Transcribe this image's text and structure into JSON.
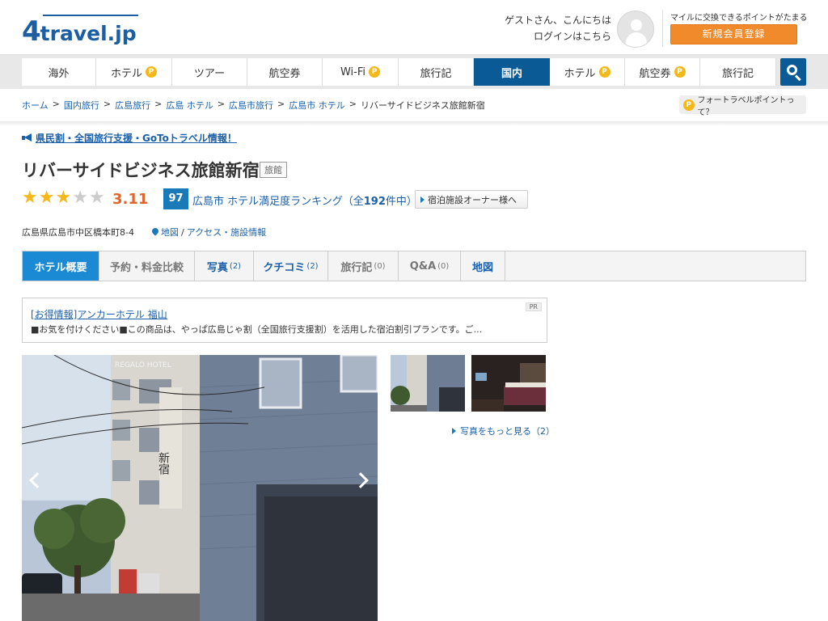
{
  "header": {
    "logo_number": "4",
    "logo_word": "travel.jp",
    "greeting_line1": "ゲストさん、こんにちは",
    "greeting_line2": "ログインはこちら",
    "points_note": "マイルに交換できるポイントがたまる",
    "register_label": "新規会員登録"
  },
  "nav": {
    "items": [
      {
        "label": "海外",
        "active": true,
        "points": false
      },
      {
        "label": "ホテル",
        "active": false,
        "points": true
      },
      {
        "label": "ツアー",
        "active": false,
        "points": false
      },
      {
        "label": "航空券",
        "active": false,
        "points": false
      },
      {
        "label": "Wi-Fi",
        "active": false,
        "points": true
      },
      {
        "label": "旅行記",
        "active": false,
        "points": false
      },
      {
        "label": "国内",
        "active": true,
        "points": false
      },
      {
        "label": "ホテル",
        "active": false,
        "points": true
      },
      {
        "label": "航空券",
        "active": false,
        "points": true
      },
      {
        "label": "旅行記",
        "active": false,
        "points": false
      }
    ],
    "points_glyph": "P"
  },
  "breadcrumb": {
    "items": [
      "ホーム",
      "国内旅行",
      "広島旅行",
      "広島 ホテル",
      "広島市旅行",
      "広島市 ホテル"
    ],
    "current": "リバーサイドビジネス旅館新宿",
    "separator": ">"
  },
  "points_help": "フォートラベルポイントって？",
  "promo": "県民割・全国旅行支援・GoToトラベル情報！",
  "hotel": {
    "name": "リバーサイドビジネス旅館新宿",
    "type": "旅館",
    "rating": 3.11,
    "rating_text": "3.11",
    "rank_score": "97",
    "rank_prefix": "広島市 ホテル満足度ランキング（全",
    "rank_count": "192",
    "rank_suffix": "件中）",
    "owner_button": "宿泊施設オーナー様へ",
    "address": "広島県広島市中区橋本町8-4",
    "map_link": "地図",
    "access_link": "アクセス・施設情報",
    "map_sep": "/"
  },
  "tabs": [
    {
      "label": "ホテル概要",
      "count": "",
      "state": "active"
    },
    {
      "label": "予約・料金比較",
      "count": "",
      "state": "plain"
    },
    {
      "label": "写真",
      "count": "(2)",
      "state": "link"
    },
    {
      "label": "クチコミ",
      "count": "(2)",
      "state": "link"
    },
    {
      "label": "旅行記",
      "count": "(0)",
      "state": "plain"
    },
    {
      "label": "Q&A",
      "count": "(0)",
      "state": "plain"
    },
    {
      "label": "地図",
      "count": "",
      "state": "link"
    }
  ],
  "ad": {
    "pr": "PR",
    "title": "[お得情報]アンカーホテル 福山",
    "description": "■お気を付けください■この商品は、やっぱ広島じゃ割（全国旅行支援割）を活用した宿泊割引プランです。ご..."
  },
  "photos": {
    "more_label": "写真をもっと見る（2）",
    "sign_text": "新宿",
    "building_sign": "REGALO HOTEL"
  },
  "colors": {
    "brand_blue": "#0a5a96",
    "tab_active": "#1a8ad4",
    "link": "#1a5fa8",
    "orange": "#f08a2a",
    "score": "#e0662a",
    "star": "#f5b819"
  }
}
